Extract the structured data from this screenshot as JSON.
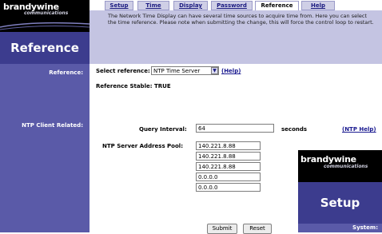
{
  "brand": {
    "logo_main": "brandywine",
    "logo_sub": "communications"
  },
  "section_title": "Reference",
  "tabs": [
    {
      "label": "Setup",
      "active": false
    },
    {
      "label": "Time",
      "active": false
    },
    {
      "label": "Display",
      "active": false
    },
    {
      "label": "Password",
      "active": false
    },
    {
      "label": "Reference",
      "active": true
    },
    {
      "label": "Help",
      "active": false
    }
  ],
  "description": "The Network Time Display can have several time sources to acquire time from. Here you can select the time reference. Please note when submitting the change, this will force the control loop to restart.",
  "left_labels": {
    "reference": "Reference:",
    "ntp_client": "NTP Client Related:"
  },
  "reference": {
    "select_label": "Select reference:",
    "selected": "NTP Time Server",
    "help_link": "(Help)",
    "stable_label": "Reference Stable:",
    "stable_value": "TRUE"
  },
  "ntp": {
    "query_label": "Query Interval:",
    "query_value": "64",
    "query_unit": "seconds",
    "help_link": "(NTP Help)",
    "pool_label": "NTP Server Address Pool:",
    "servers": [
      "140.221.8.88",
      "140.221.8.88",
      "140.221.8.88",
      "0.0.0.0",
      "0.0.0.0"
    ]
  },
  "buttons": {
    "submit": "Submit",
    "reset": "Reset"
  },
  "popup": {
    "logo_main": "brandywine",
    "logo_sub": "communications",
    "title": "Setup",
    "system_label": "System:"
  },
  "colors": {
    "left_column": "#5a5aa8",
    "title_bar": "#3c3c8e",
    "desc_bg": "#c4c4e2",
    "tab_bg": "#cfcfe6"
  }
}
